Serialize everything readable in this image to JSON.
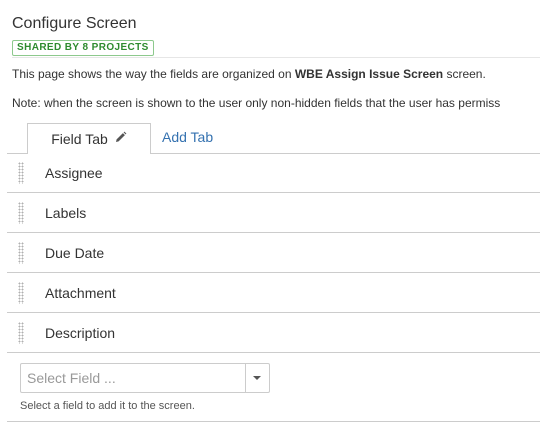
{
  "page": {
    "title": "Configure Screen",
    "shared_badge": "SHARED BY 8 PROJECTS",
    "desc_prefix": "This page shows the way the fields are organized on ",
    "screen_name": "WBE Assign Issue Screen",
    "desc_suffix": " screen.",
    "note": "Note: when the screen is shown to the user only non-hidden fields that the user has permiss"
  },
  "tabs": {
    "active_label": "Field Tab",
    "active_icon": "pencil-icon",
    "add_label": "Add Tab"
  },
  "fields": [
    {
      "label": "Assignee"
    },
    {
      "label": "Labels"
    },
    {
      "label": "Due Date"
    },
    {
      "label": "Attachment"
    },
    {
      "label": "Description"
    }
  ],
  "add_field": {
    "placeholder": "Select Field ...",
    "value": "",
    "help": "Select a field to add it to the screen."
  },
  "colors": {
    "link": "#3572b0",
    "badge_text": "#2e8b2e",
    "badge_border": "#8dc98d",
    "divider": "#cccccc"
  }
}
